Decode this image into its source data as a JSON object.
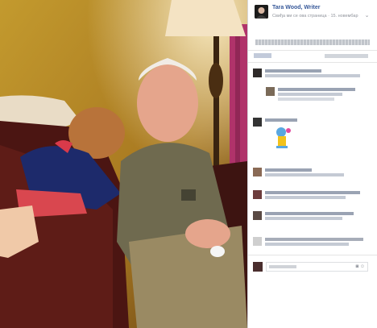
{
  "post": {
    "page_name": "Tara Wood, Writer",
    "like_page_label": "Свиђа ми се ова страница",
    "date": "15. новембар",
    "options_icon": "chevron-down-icon"
  },
  "photo": {
    "alt": "grandfather-and-child-photo"
  },
  "comment_box": {
    "camera_icon": "camera-icon",
    "sticker_icon": "sticker-icon"
  },
  "colors": {
    "link": "#365899",
    "meta": "#90949c"
  }
}
